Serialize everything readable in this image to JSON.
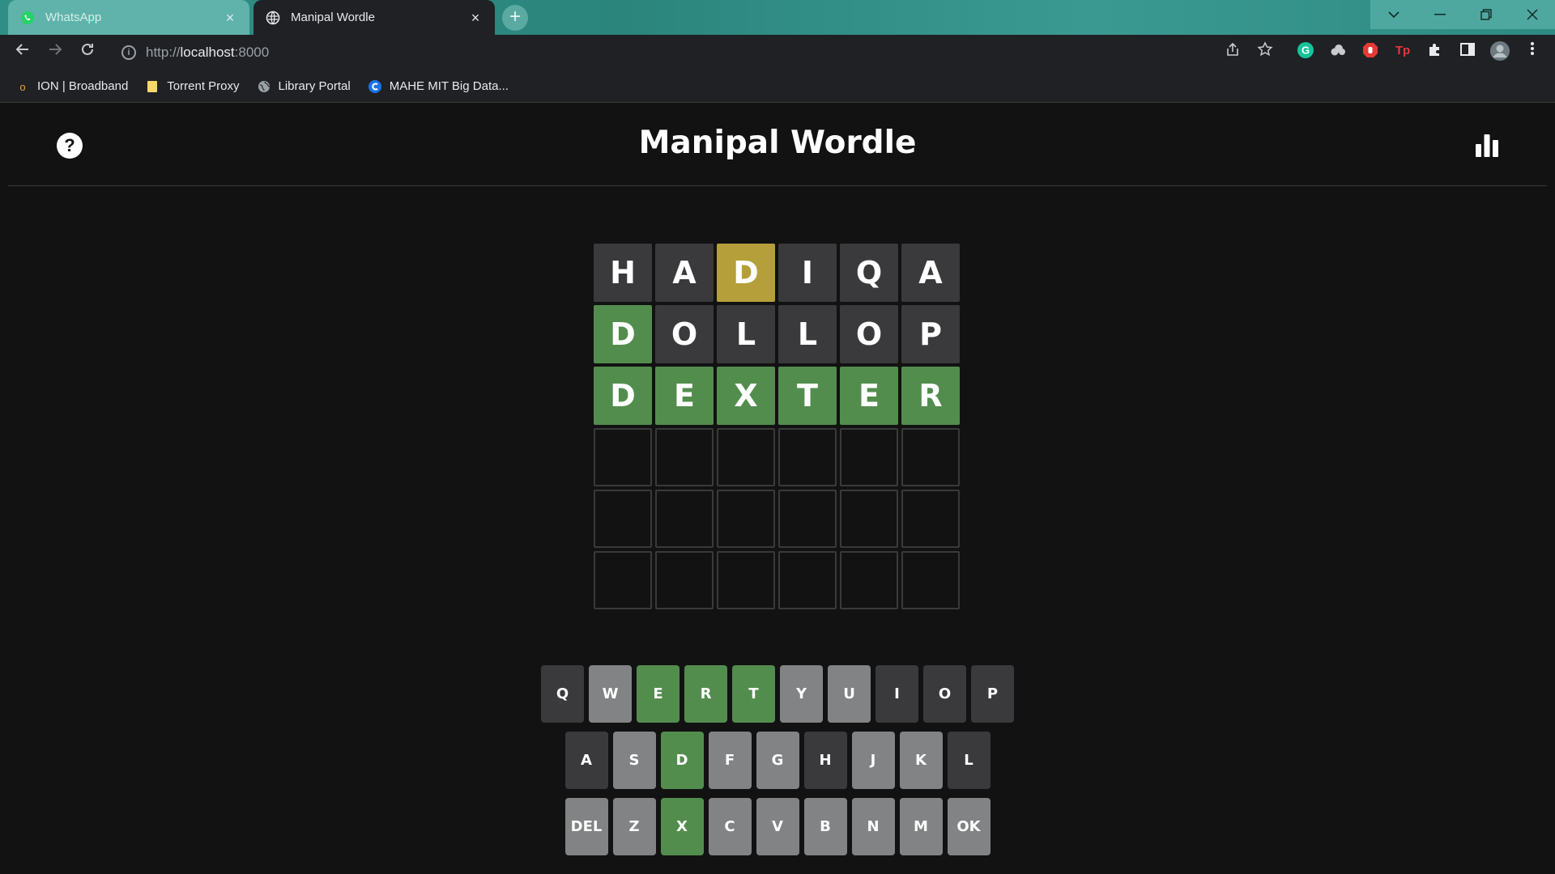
{
  "browser": {
    "tabs": [
      {
        "title": "WhatsApp",
        "close": "×",
        "active": false,
        "icon": "whatsapp-icon"
      },
      {
        "title": "Manipal Wordle",
        "close": "×",
        "active": true,
        "icon": "globe-icon"
      }
    ],
    "new_tab": "+",
    "url_prefix": "http://",
    "url_host": "localhost",
    "url_suffix": ":8000",
    "bookmarks": [
      {
        "label": "ION | Broadband",
        "icon": "ion-icon",
        "color": "#e8a33d"
      },
      {
        "label": "Torrent Proxy",
        "icon": "folder-icon",
        "color": "#f5d76e"
      },
      {
        "label": "Library Portal",
        "icon": "globe-icon",
        "color": "#9aa0a6"
      },
      {
        "label": "MAHE MIT Big Data...",
        "icon": "c-icon",
        "color": "#1a73e8"
      }
    ]
  },
  "game": {
    "title": "Manipal Wordle",
    "help_label": "?",
    "board": [
      [
        {
          "l": "H",
          "s": "absent"
        },
        {
          "l": "A",
          "s": "absent"
        },
        {
          "l": "D",
          "s": "present"
        },
        {
          "l": "I",
          "s": "absent"
        },
        {
          "l": "Q",
          "s": "absent"
        },
        {
          "l": "A",
          "s": "absent"
        }
      ],
      [
        {
          "l": "D",
          "s": "correct"
        },
        {
          "l": "O",
          "s": "absent"
        },
        {
          "l": "L",
          "s": "absent"
        },
        {
          "l": "L",
          "s": "absent"
        },
        {
          "l": "O",
          "s": "absent"
        },
        {
          "l": "P",
          "s": "absent"
        }
      ],
      [
        {
          "l": "D",
          "s": "correct"
        },
        {
          "l": "E",
          "s": "correct"
        },
        {
          "l": "X",
          "s": "correct"
        },
        {
          "l": "T",
          "s": "correct"
        },
        {
          "l": "E",
          "s": "correct"
        },
        {
          "l": "R",
          "s": "correct"
        }
      ],
      [
        {
          "l": "",
          "s": "empty"
        },
        {
          "l": "",
          "s": "empty"
        },
        {
          "l": "",
          "s": "empty"
        },
        {
          "l": "",
          "s": "empty"
        },
        {
          "l": "",
          "s": "empty"
        },
        {
          "l": "",
          "s": "empty"
        }
      ],
      [
        {
          "l": "",
          "s": "empty"
        },
        {
          "l": "",
          "s": "empty"
        },
        {
          "l": "",
          "s": "empty"
        },
        {
          "l": "",
          "s": "empty"
        },
        {
          "l": "",
          "s": "empty"
        },
        {
          "l": "",
          "s": "empty"
        }
      ],
      [
        {
          "l": "",
          "s": "empty"
        },
        {
          "l": "",
          "s": "empty"
        },
        {
          "l": "",
          "s": "empty"
        },
        {
          "l": "",
          "s": "empty"
        },
        {
          "l": "",
          "s": "empty"
        },
        {
          "l": "",
          "s": "empty"
        }
      ]
    ],
    "keyboard": [
      [
        {
          "k": "Q",
          "s": "absent"
        },
        {
          "k": "W",
          "s": "unused"
        },
        {
          "k": "E",
          "s": "correct"
        },
        {
          "k": "R",
          "s": "correct"
        },
        {
          "k": "T",
          "s": "correct"
        },
        {
          "k": "Y",
          "s": "unused"
        },
        {
          "k": "U",
          "s": "unused"
        },
        {
          "k": "I",
          "s": "absent"
        },
        {
          "k": "O",
          "s": "absent"
        },
        {
          "k": "P",
          "s": "absent"
        }
      ],
      [
        {
          "k": "A",
          "s": "absent"
        },
        {
          "k": "S",
          "s": "unused"
        },
        {
          "k": "D",
          "s": "correct"
        },
        {
          "k": "F",
          "s": "unused"
        },
        {
          "k": "G",
          "s": "unused"
        },
        {
          "k": "H",
          "s": "absent"
        },
        {
          "k": "J",
          "s": "unused"
        },
        {
          "k": "K",
          "s": "unused"
        },
        {
          "k": "L",
          "s": "absent"
        }
      ],
      [
        {
          "k": "DEL",
          "s": "unused"
        },
        {
          "k": "Z",
          "s": "unused"
        },
        {
          "k": "X",
          "s": "correct"
        },
        {
          "k": "C",
          "s": "unused"
        },
        {
          "k": "V",
          "s": "unused"
        },
        {
          "k": "B",
          "s": "unused"
        },
        {
          "k": "N",
          "s": "unused"
        },
        {
          "k": "M",
          "s": "unused"
        },
        {
          "k": "OK",
          "s": "unused"
        }
      ]
    ],
    "colors": {
      "correct": "#538d4e",
      "present": "#b59f3b",
      "absent": "#3a3a3c",
      "unused": "#818384",
      "background": "#121213"
    }
  }
}
